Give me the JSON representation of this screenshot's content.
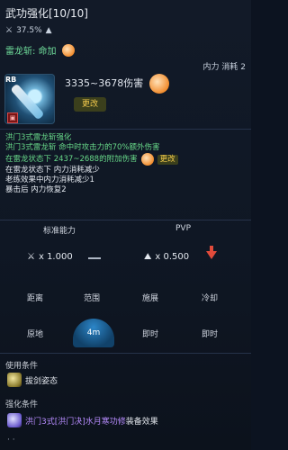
{
  "title": "武功强化[10/10]",
  "stat": {
    "value": "37.5%",
    "icon": "crossed-swords-icon"
  },
  "skill": {
    "name": "雷龙斩: 命加",
    "resource": "内力 消耗 2",
    "rb": "RB",
    "damage": "3335~3678伤害",
    "change": "更改"
  },
  "description": [
    {
      "text": "洪门3式雷龙斩强化",
      "color": "green"
    },
    {
      "text": "洪门3式雷龙斩 命中时攻击力的70%额外伤害",
      "color": "green"
    },
    {
      "text": "在雷龙状态下 2437~2688的附加伤害",
      "color": "green",
      "change": "更改"
    },
    {
      "text": "在雷龙状态下 内力消耗减少",
      "color": "white"
    },
    {
      "text": "老练效果中内力消耗减少1",
      "color": "white"
    },
    {
      "text": "暴击后 内力恢复2",
      "color": "white"
    }
  ],
  "grid": {
    "standard_label": "标准能力",
    "pvp_label": "PVP",
    "standard_mult": "x 1.000",
    "pvp_mult": "x 0.500",
    "props": [
      "距离",
      "范围",
      "施展",
      "冷却"
    ],
    "values": [
      "原地",
      "4m",
      "即时",
      "即时"
    ]
  },
  "use_condition": {
    "title": "使用条件",
    "text": "拔剑姿态"
  },
  "enhance_condition": {
    "title": "强化条件",
    "text": "洪门3式[洪门决]水月寒功修",
    "suffix": "装备效果"
  },
  "colors": {
    "green": "#67d889",
    "title": "#e9edf3",
    "accent": "#f2c94c",
    "red": "#e14b3b"
  }
}
